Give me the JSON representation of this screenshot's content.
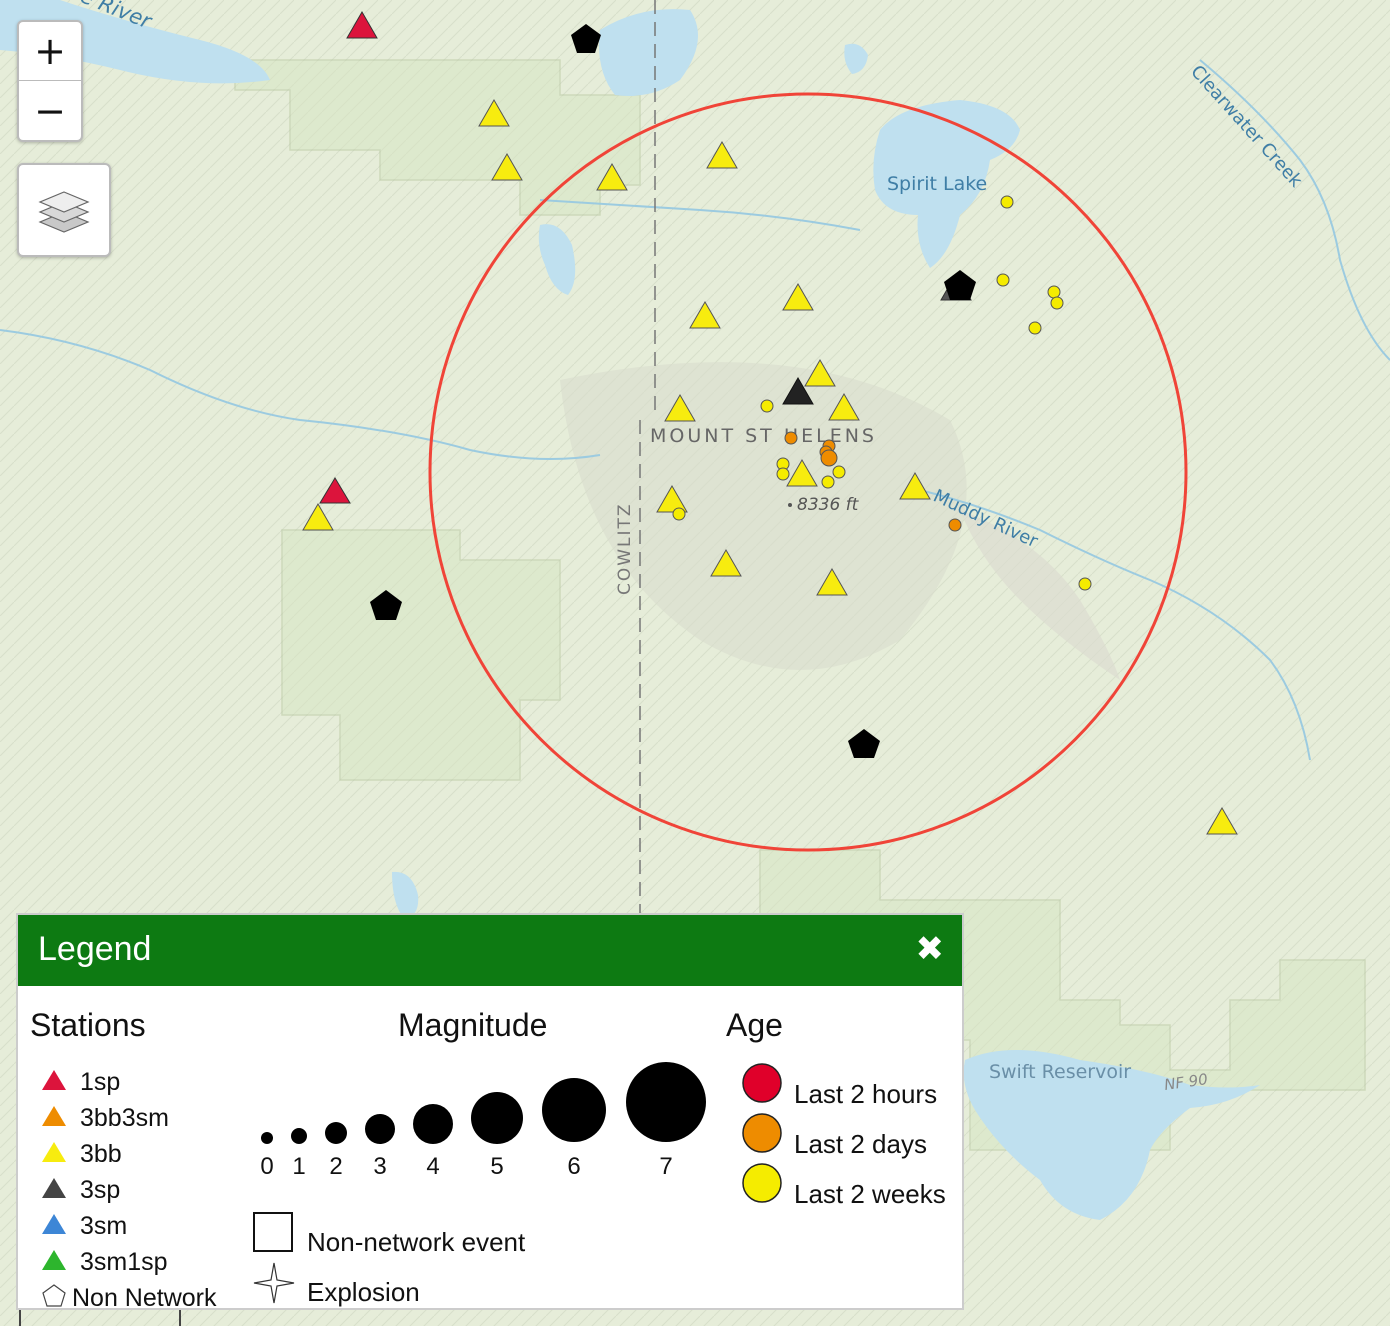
{
  "map": {
    "labels": {
      "toutle_river": "Toutle River",
      "clearwater_creek": "Clearwater Creek",
      "spirit_lake": "Spirit Lake",
      "mount_st_helens": "MOUNT ST HELENS",
      "summit_elevation": "8336 ft",
      "cowlitz": "COWLITZ",
      "muddy_river": "Muddy River",
      "swift_reservoir": "Swift Reservoir",
      "nf_90": "NF 90"
    },
    "colors": {
      "sp1": "#dc143c",
      "bb3sm": "#ee8c00",
      "bb": "#f7ec0f",
      "sp3": "#444444",
      "sm3": "#3d86d6",
      "sm1sp": "#2db52d",
      "non_network": "#000000",
      "age_2h": "#e0002a",
      "age_2d": "#ee8c00",
      "age_2w": "#f5ec00",
      "radius_circle": "#f04438"
    }
  },
  "controls": {
    "zoom_in": "+",
    "zoom_out": "−"
  },
  "legend": {
    "title": "Legend",
    "close": "✖",
    "stations_heading": "Stations",
    "stations": [
      {
        "label": "1sp",
        "color": "#dc143c"
      },
      {
        "label": "3bb3sm",
        "color": "#ee8c00"
      },
      {
        "label": "3bb",
        "color": "#f7ec0f"
      },
      {
        "label": "3sp",
        "color": "#444444"
      },
      {
        "label": "3sm",
        "color": "#3d86d6"
      },
      {
        "label": "3sm1sp",
        "color": "#2db52d"
      },
      {
        "label": "Non Network",
        "color": "#ffffff"
      }
    ],
    "magnitude_heading": "Magnitude",
    "magnitudes": [
      "0",
      "1",
      "2",
      "3",
      "4",
      "5",
      "6",
      "7"
    ],
    "age_heading": "Age",
    "ages": [
      {
        "label": "Last 2 hours",
        "color": "#e0002a"
      },
      {
        "label": "Last 2 days",
        "color": "#ee8c00"
      },
      {
        "label": "Last 2 weeks",
        "color": "#f5ec00"
      }
    ],
    "non_network_event": "Non-network event",
    "explosion": "Explosion"
  }
}
